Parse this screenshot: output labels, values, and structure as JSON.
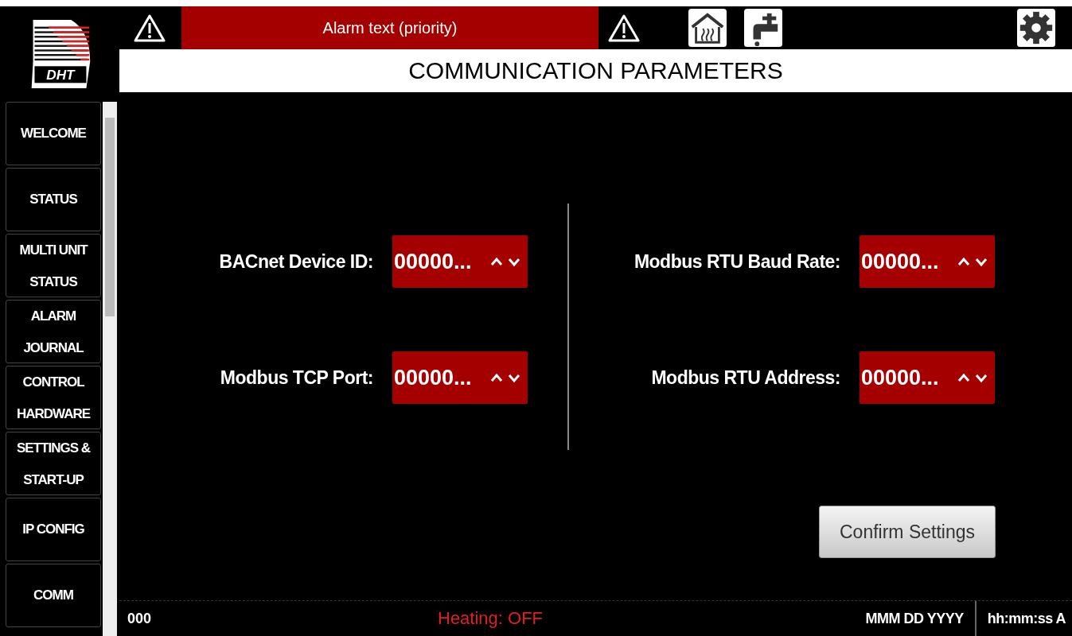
{
  "logo_text": "DHT",
  "header": {
    "alarm_text": "Alarm text (priority)",
    "title": "COMMUNICATION PARAMETERS"
  },
  "nav": [
    {
      "label": "WELCOME"
    },
    {
      "label": "STATUS"
    },
    {
      "label": "MULTI UNIT STATUS"
    },
    {
      "label": "ALARM JOURNAL"
    },
    {
      "label": "CONTROL HARDWARE"
    },
    {
      "label": "SETTINGS & START-UP"
    },
    {
      "label": "IP CONFIG"
    },
    {
      "label": "COMM"
    }
  ],
  "left_fields": [
    {
      "label": "BACnet Device ID:",
      "value": "00000..."
    },
    {
      "label": "Modbus TCP Port:",
      "value": "00000..."
    }
  ],
  "right_fields": [
    {
      "label": "Modbus RTU Baud Rate:",
      "value": "00000..."
    },
    {
      "label": "Modbus RTU Address:",
      "value": "00000..."
    }
  ],
  "confirm_button": "Confirm Settings",
  "status_bar": {
    "code": "000",
    "heating": "Heating: OFF",
    "date": "MMM DD YYYY",
    "time": "hh:mm:ss A"
  }
}
